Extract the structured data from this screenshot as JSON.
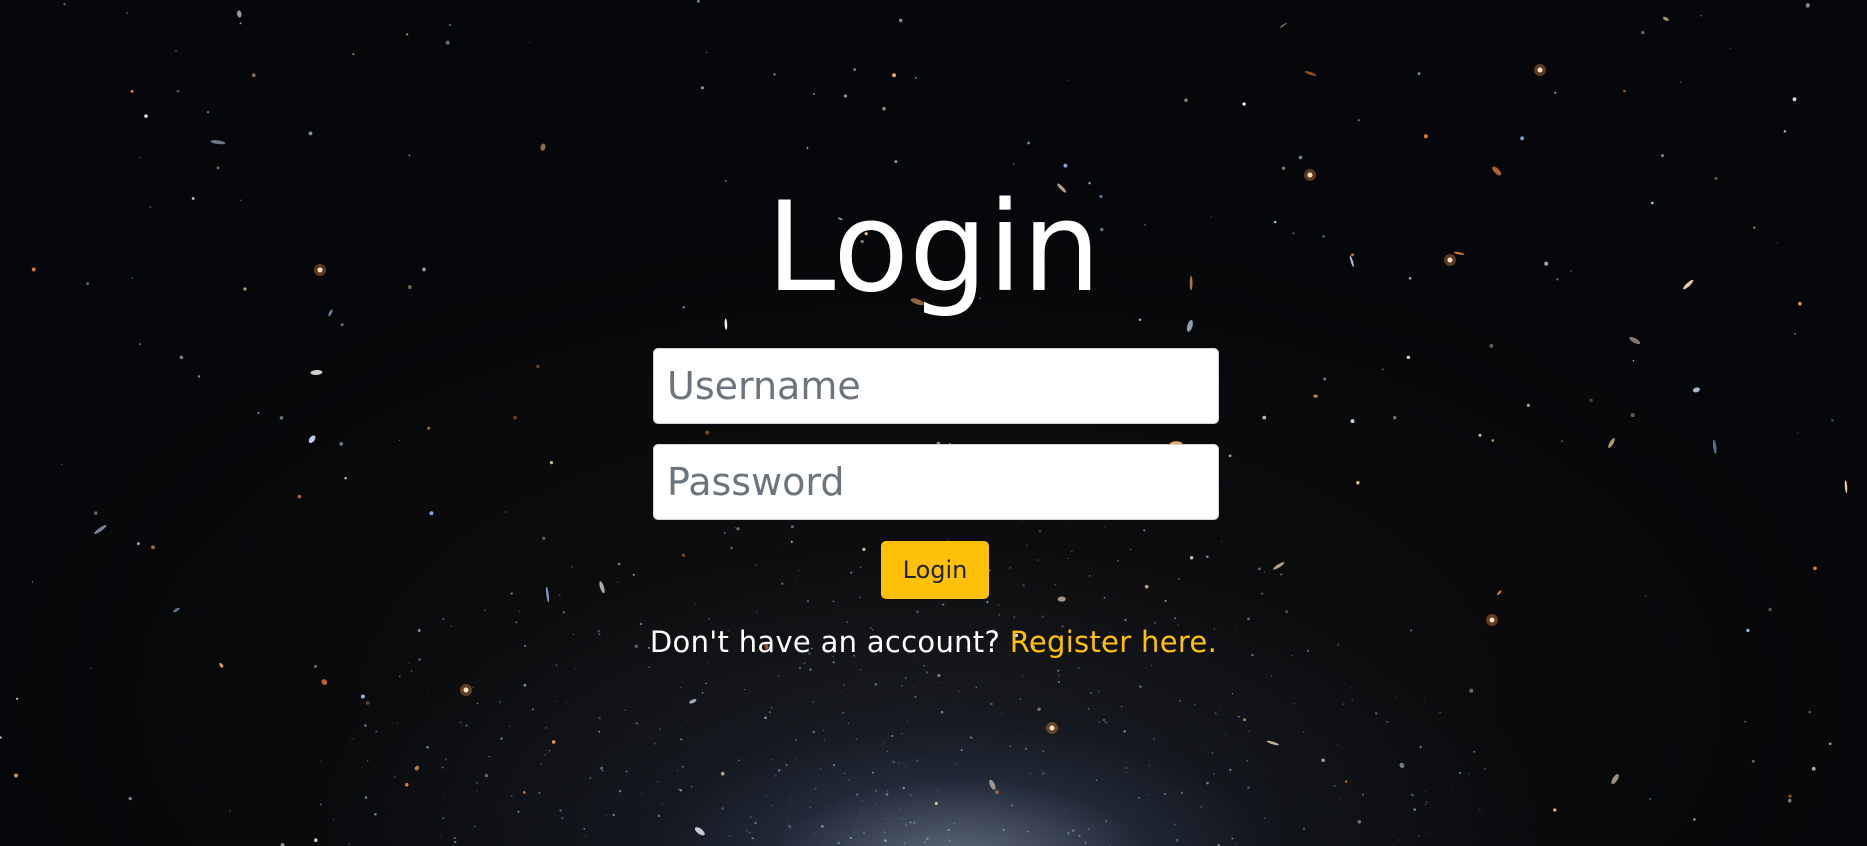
{
  "page": {
    "background": "deep-space-galaxy-field"
  },
  "login": {
    "title": "Login",
    "username_placeholder": "Username",
    "username_value": "",
    "password_placeholder": "Password",
    "password_value": "",
    "submit_label": "Login",
    "register_prompt": "Don't have an account?",
    "register_link_label": "Register here."
  },
  "colors": {
    "accent": "#ffc107",
    "title_text": "#ffffff",
    "input_background": "#ffffff",
    "placeholder_text": "#6c757d",
    "page_background": "#06070a"
  }
}
